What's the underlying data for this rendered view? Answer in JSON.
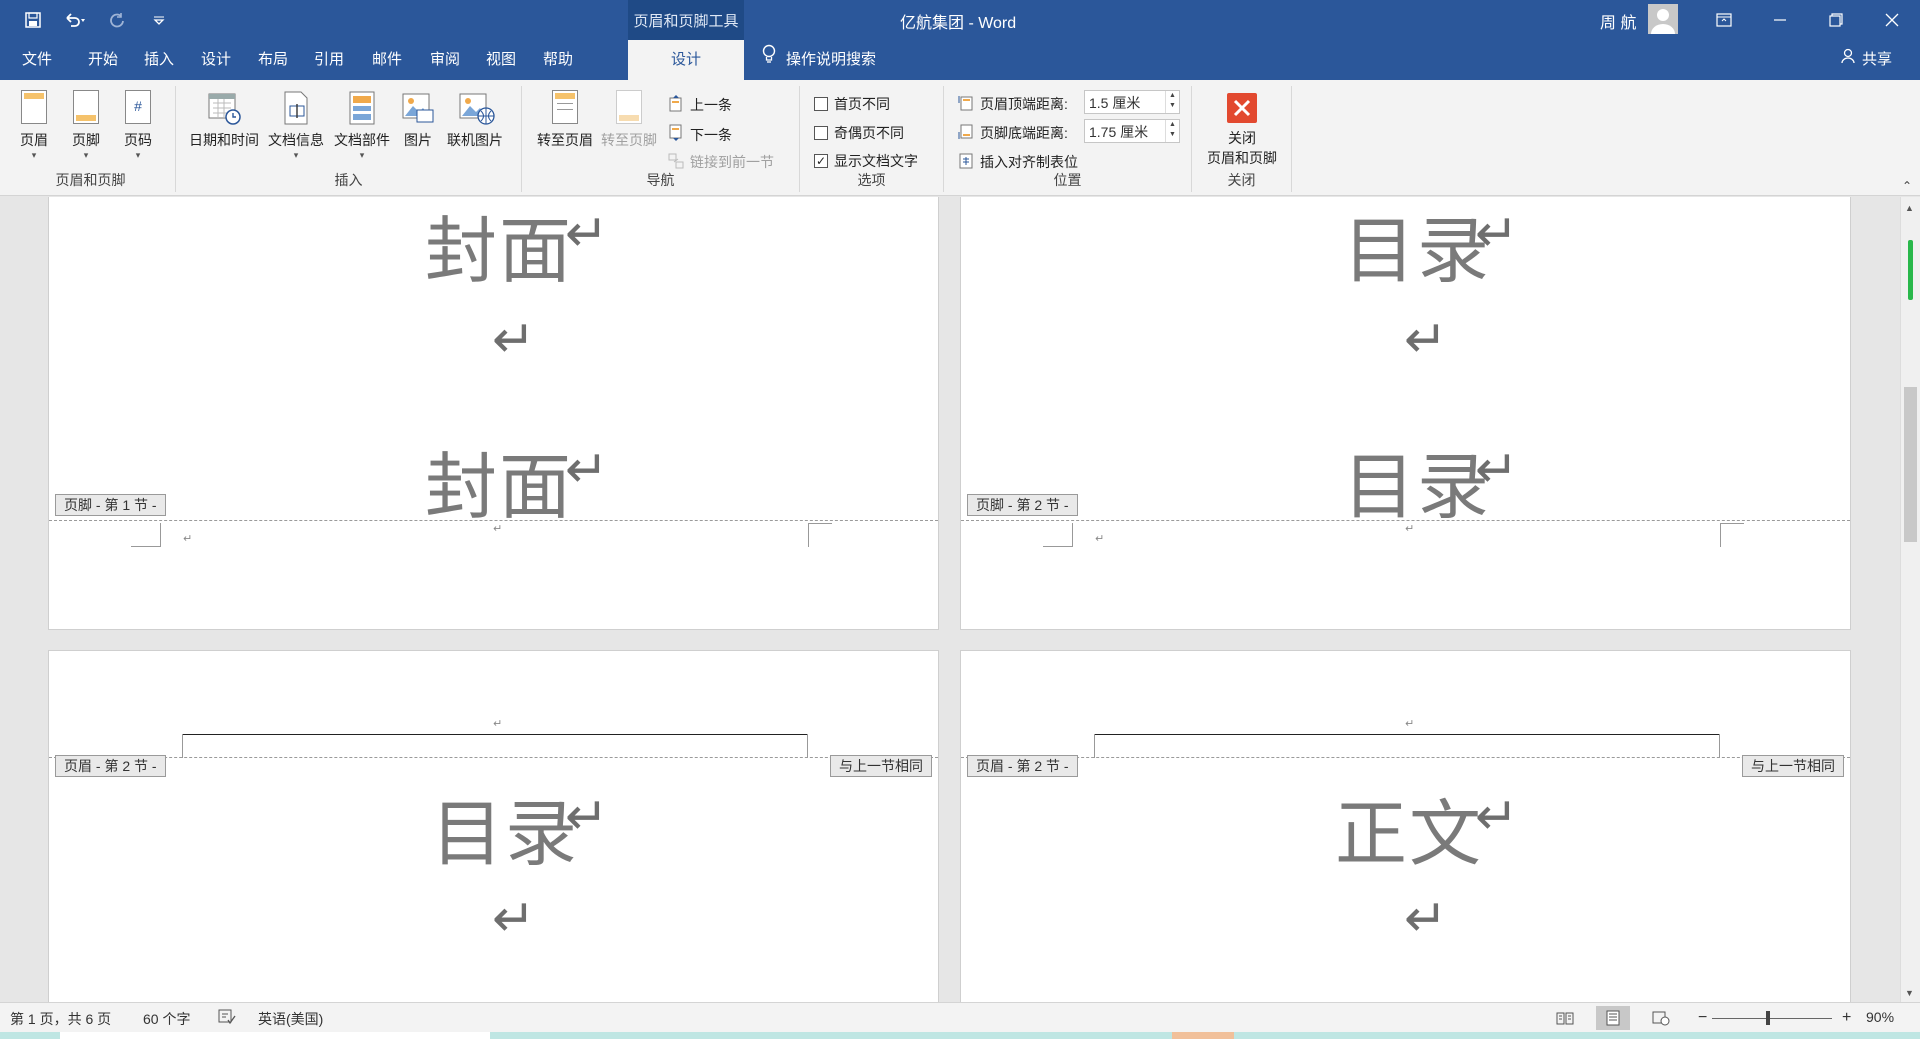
{
  "window": {
    "contextual_tab_group": "页眉和页脚工具",
    "title": "亿航集团 - Word",
    "user_name": "周 航"
  },
  "tabs": [
    "文件",
    "开始",
    "插入",
    "设计",
    "布局",
    "引用",
    "邮件",
    "审阅",
    "视图",
    "帮助"
  ],
  "active_tab": "设计",
  "tell_me": "操作说明搜索",
  "share": "共享",
  "ribbon": {
    "groups": {
      "header_footer": {
        "label": "页眉和页脚",
        "buttons": [
          "页眉",
          "页脚",
          "页码"
        ]
      },
      "insert": {
        "label": "插入",
        "buttons": [
          "日期和时间",
          "文档信息",
          "文档部件",
          "图片",
          "联机图片"
        ]
      },
      "navigation": {
        "label": "导航",
        "goto_header": "转至页眉",
        "goto_footer": "转至页脚",
        "previous": "上一条",
        "next": "下一条",
        "link_previous": "链接到前一节"
      },
      "options": {
        "label": "选项",
        "different_first_page": "首页不同",
        "different_odd_even": "奇偶页不同",
        "show_document_text": "显示文档文字",
        "show_document_text_checked": true
      },
      "position": {
        "label": "位置",
        "header_from_top_label": "页眉顶端距离:",
        "header_from_top_value": "1.5 厘米",
        "footer_from_bottom_label": "页脚底端距离:",
        "footer_from_bottom_value": "1.75 厘米",
        "insert_alignment_tab": "插入对齐制表位"
      },
      "close": {
        "label": "关闭",
        "button_line1": "关闭",
        "button_line2": "页眉和页脚"
      }
    }
  },
  "pages": {
    "p1": {
      "heading": "封面",
      "heading2": "封面",
      "footer_tag": "页脚 - 第 1 节 -"
    },
    "p2": {
      "heading": "目录",
      "heading2": "目录",
      "footer_tag": "页脚 - 第 2 节 -"
    },
    "p3": {
      "header_tag": "页眉 - 第 2 节 -",
      "same_as_previous": "与上一节相同",
      "heading": "目录"
    },
    "p4": {
      "header_tag": "页眉 - 第 2 节 -",
      "same_as_previous": "与上一节相同",
      "heading": "正文"
    },
    "return_mark": "↵"
  },
  "status": {
    "page": "第 1 页，共 6 页",
    "words": "60 个字",
    "language": "英语(美国)",
    "zoom": "90%",
    "zoom_level": 0.9
  }
}
